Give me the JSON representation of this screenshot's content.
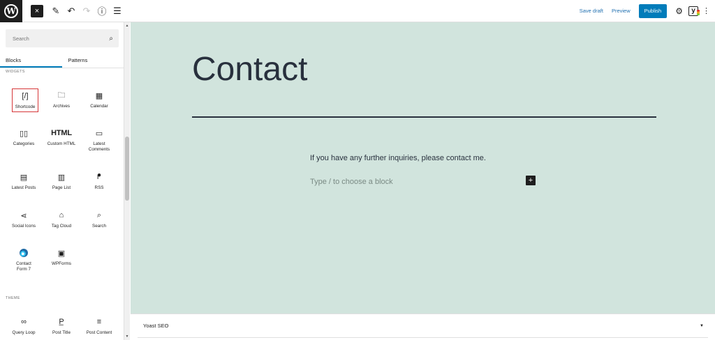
{
  "toolbar": {
    "close_icon": "×",
    "pencil_icon": "✎",
    "undo_icon": "↶",
    "redo_icon": "↷",
    "info_icon": "ⓘ",
    "list_view_icon": "☰",
    "save_draft": "Save draft",
    "preview": "Preview",
    "publish": "Publish",
    "settings_icon": "⚙",
    "yoast_letter": "y",
    "options_icon": "⋮"
  },
  "sidebar": {
    "search_placeholder": "Search",
    "search_icon": "⌕",
    "tabs": [
      {
        "label": "Blocks"
      },
      {
        "label": "Patterns"
      }
    ],
    "sections": {
      "widgets": "WIDGETS",
      "theme": "THEME"
    },
    "widgets": [
      {
        "label": "Shortcode",
        "glyph": "[/]"
      },
      {
        "label": "Archives",
        "glyph": "🗀"
      },
      {
        "label": "Calendar",
        "glyph": "▦"
      },
      {
        "label": "Categories",
        "glyph": "▯▯"
      },
      {
        "label": "Custom HTML",
        "glyph": "HTML"
      },
      {
        "label": "Latest Comments",
        "glyph": "▭"
      },
      {
        "label": "Latest Posts",
        "glyph": "▤"
      },
      {
        "label": "Page List",
        "glyph": "▥"
      },
      {
        "label": "RSS",
        "glyph": "ᖰ"
      },
      {
        "label": "Social Icons",
        "glyph": "⋖"
      },
      {
        "label": "Tag Cloud",
        "glyph": "⌂"
      },
      {
        "label": "Search",
        "glyph": "⌕"
      },
      {
        "label": "Contact Form 7",
        "glyph": ""
      },
      {
        "label": "WPForms",
        "glyph": "▣"
      }
    ],
    "theme_blocks": [
      {
        "label": "Query Loop",
        "glyph": "∞"
      },
      {
        "label": "Post Title",
        "glyph": "P̲"
      },
      {
        "label": "Post Content",
        "glyph": "≡"
      }
    ]
  },
  "canvas": {
    "title": "Contact",
    "paragraph": "If you have any further inquiries, please contact me.",
    "block_placeholder": "Type / to choose a block",
    "add_block_icon": "+"
  },
  "metabox": {
    "title": "Yoast SEO",
    "toggle_icon": "▼"
  }
}
